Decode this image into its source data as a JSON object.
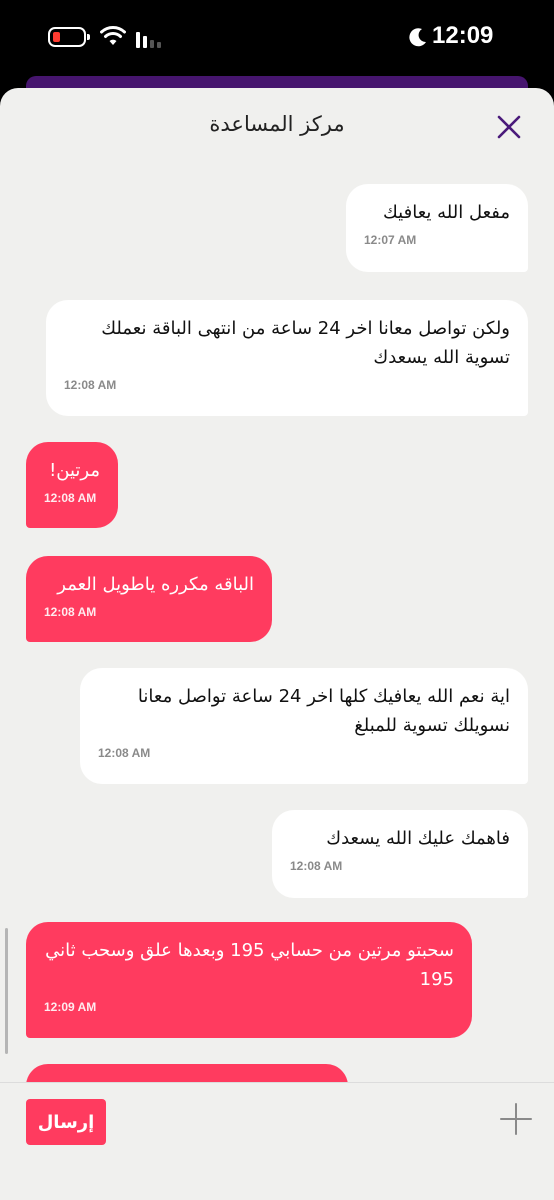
{
  "status_bar": {
    "time": "12:09",
    "icons": [
      "battery-low-icon",
      "wifi-icon",
      "cellular-signal-icon",
      "moon-icon"
    ],
    "battery_color": "#ff3b30"
  },
  "header": {
    "title": "مركز المساعدة",
    "close_icon": "close-icon",
    "close_color": "#4a1a7a"
  },
  "messages": [
    {
      "sender": "agent",
      "text": "مفعل الله يعافيك",
      "time": "12:07 AM"
    },
    {
      "sender": "agent",
      "text": "ولكن تواصل معانا اخر 24 ساعة من انتهى الباقة نعملك تسوية الله يسعدك",
      "time": "12:08 AM"
    },
    {
      "sender": "user",
      "text": "مرتين!",
      "time": "12:08 AM"
    },
    {
      "sender": "user",
      "text": "الباقه مكرره ياطويل العمر",
      "time": "12:08 AM"
    },
    {
      "sender": "agent",
      "text": "اية نعم الله يعافيك كلها اخر 24 ساعة تواصل معانا نسويلك تسوية للمبلغ",
      "time": "12:08 AM"
    },
    {
      "sender": "agent",
      "text": "فاهمك عليك الله يسعدك",
      "time": "12:08 AM"
    },
    {
      "sender": "user",
      "text": "سحبتو مرتين من حسابي 195 وبعدها علق وسحب ثاني 195",
      "time": "12:09 AM"
    }
  ],
  "footer": {
    "send_label": "إرسال",
    "plus_icon": "plus-icon"
  },
  "colors": {
    "user_bubble": "#ff3b5f",
    "agent_bubble": "#ffffff",
    "background": "#f0f0ee",
    "accent_purple": "#46156e"
  }
}
